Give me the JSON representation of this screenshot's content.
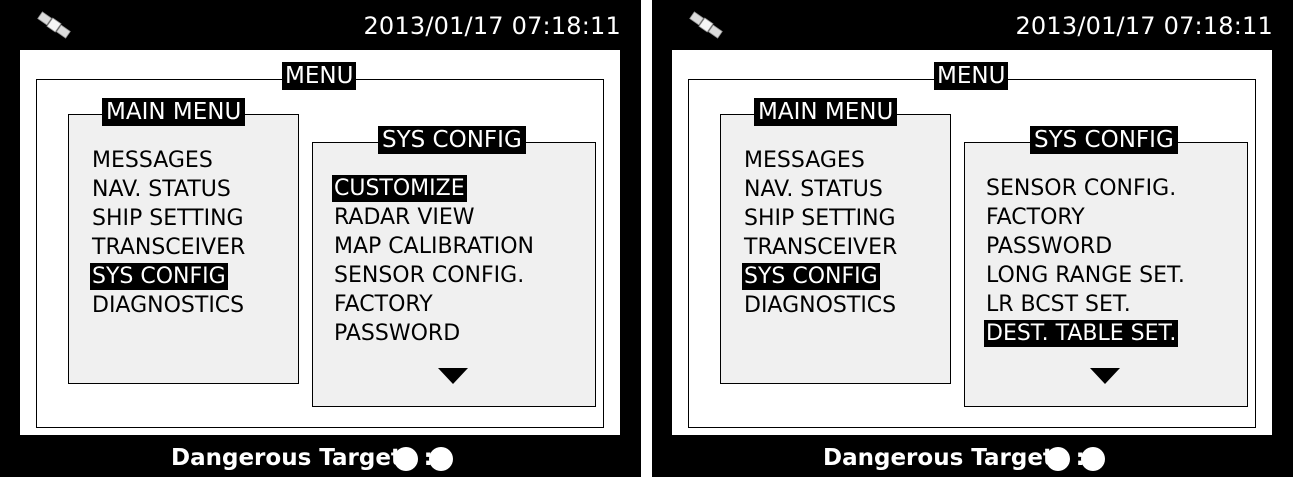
{
  "screens": [
    {
      "datetime": "2013/01/17 07:18:11",
      "frame_title": "MENU",
      "main_menu": {
        "title": "MAIN MENU",
        "items": [
          "MESSAGES",
          "NAV. STATUS",
          "SHIP SETTING",
          "TRANSCEIVER",
          "SYS CONFIG",
          "DIAGNOSTICS"
        ],
        "selected": "SYS CONFIG"
      },
      "sys_config": {
        "title": "SYS CONFIG",
        "items": [
          "CUSTOMIZE",
          "RADAR VIEW",
          "MAP CALIBRATION",
          "SENSOR CONFIG.",
          "FACTORY",
          "PASSWORD"
        ],
        "selected": "CUSTOMIZE",
        "more_icon": "triangle-down-icon"
      },
      "status": {
        "dangerous_targets": "Dangerous Targets :0"
      },
      "icons": {
        "satellite": "satellite-icon",
        "indicators": [
          "white-dot-icon",
          "white-dot-icon"
        ]
      }
    },
    {
      "datetime": "2013/01/17 07:18:11",
      "frame_title": "MENU",
      "main_menu": {
        "title": "MAIN MENU",
        "items": [
          "MESSAGES",
          "NAV. STATUS",
          "SHIP SETTING",
          "TRANSCEIVER",
          "SYS CONFIG",
          "DIAGNOSTICS"
        ],
        "selected": "SYS CONFIG"
      },
      "sys_config": {
        "title": "SYS CONFIG",
        "items": [
          "SENSOR CONFIG.",
          "FACTORY",
          "PASSWORD",
          "LONG RANGE SET.",
          "LR BCST SET.",
          "DEST. TABLE SET."
        ],
        "selected": "DEST. TABLE SET.",
        "more_icon": "triangle-down-icon"
      },
      "status": {
        "dangerous_targets": "Dangerous Targets :0"
      },
      "icons": {
        "satellite": "satellite-icon",
        "indicators": [
          "white-dot-icon",
          "white-dot-icon"
        ]
      }
    }
  ],
  "colors": {
    "screen_bg": "#000000",
    "content_bg": "#ffffff",
    "panel_bg": "#f0f0f0",
    "highlight_bg": "#000000",
    "highlight_text": "#ffffff"
  }
}
